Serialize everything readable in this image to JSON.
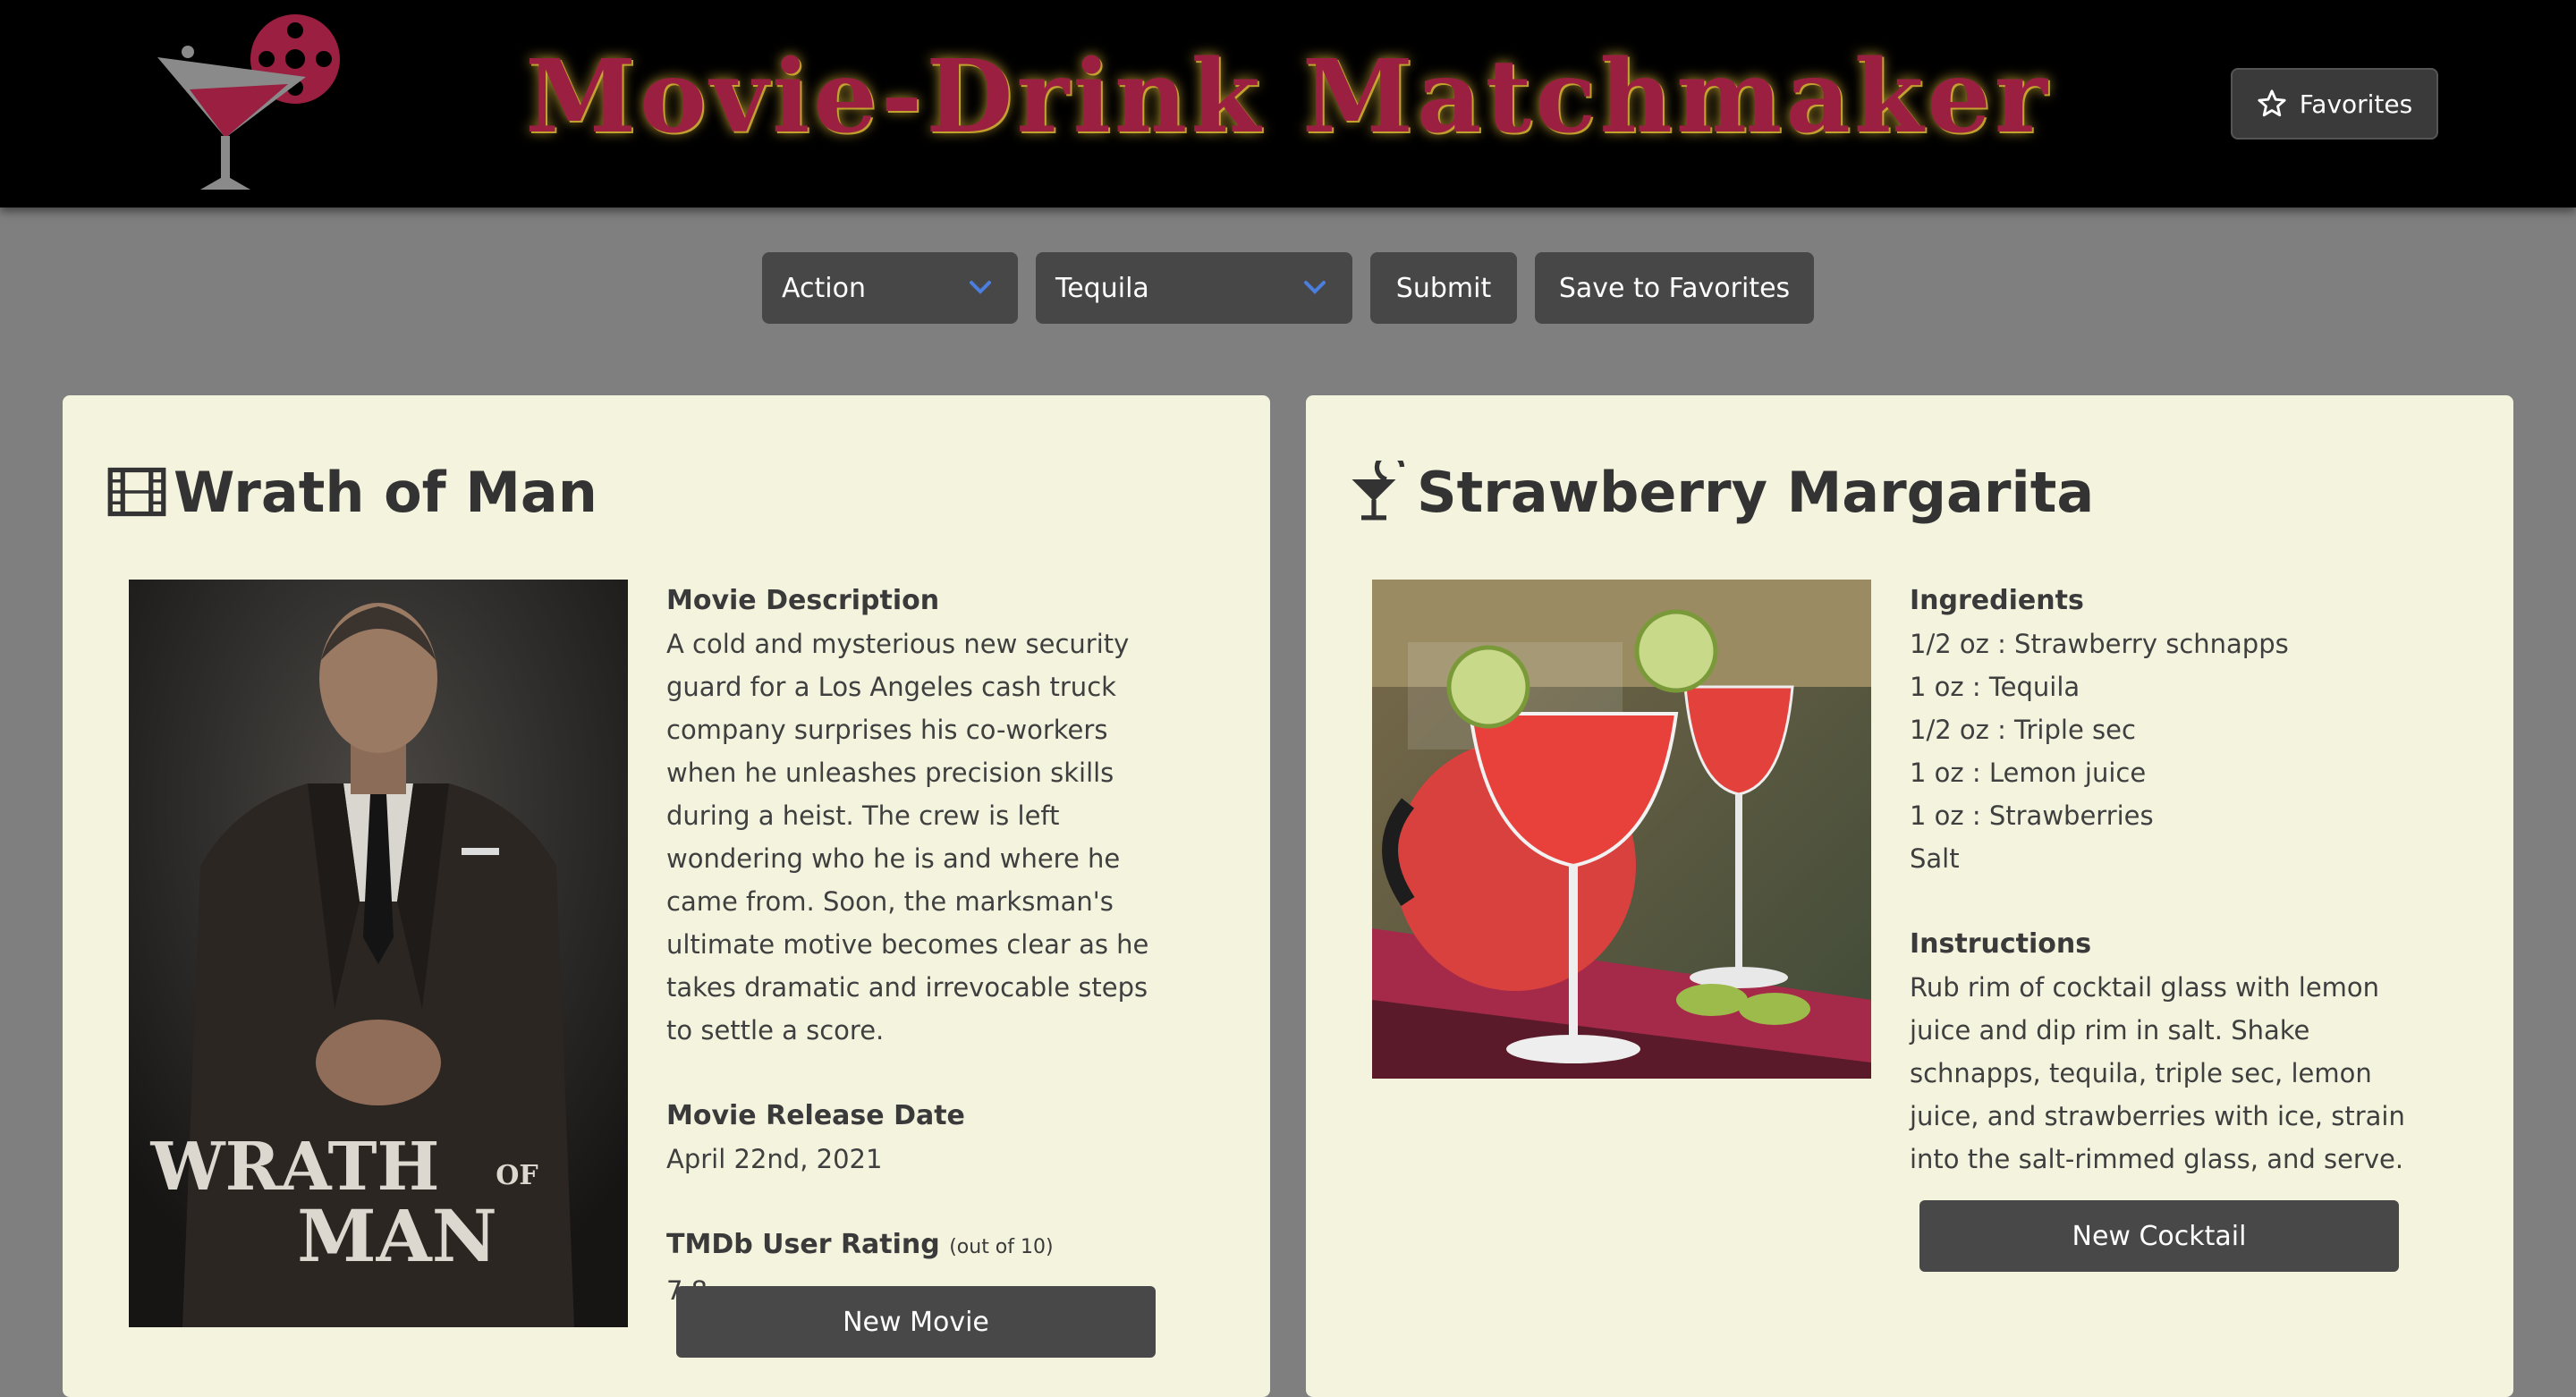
{
  "header": {
    "title": "Movie-Drink Matchmaker",
    "favorites_label": "Favorites",
    "logo_icon": "martini-film-reel-logo"
  },
  "controls": {
    "genre_select": {
      "selected": "Action"
    },
    "spirit_select": {
      "selected": "Tequila"
    },
    "submit_label": "Submit",
    "save_label": "Save to Favorites"
  },
  "movie": {
    "title": "Wrath of Man",
    "title_icon": "film-icon",
    "poster_text_1": "WRATH",
    "poster_text_of": "OF",
    "poster_text_2": "MAN",
    "description_heading": "Movie Description",
    "description": "A cold and mysterious new security guard for a Los Angeles cash truck company surprises his co-workers when he unleashes precision skills during a heist. The crew is left wondering who he is and where he came from. Soon, the marksman's ultimate motive becomes clear as he takes dramatic and irrevocable steps to settle a score.",
    "release_heading": "Movie Release Date",
    "release_date": "April 22nd, 2021",
    "rating_heading": "TMDb User Rating",
    "rating_scale": "(out of 10)",
    "rating": "7.8",
    "new_button": "New Movie"
  },
  "cocktail": {
    "title": "Strawberry Margarita",
    "title_icon": "cocktail-icon",
    "ingredients_heading": "Ingredients",
    "ingredients": [
      "1/2 oz : Strawberry schnapps",
      "1 oz : Tequila",
      "1/2 oz : Triple sec",
      "1 oz : Lemon juice",
      "1 oz : Strawberries",
      "Salt"
    ],
    "instructions_heading": "Instructions",
    "instructions": "Rub rim of cocktail glass with lemon juice and dip rim in salt. Shake schnapps, tequila, triple sec, lemon juice, and strawberries with ice, strain into the salt-rimmed glass, and serve.",
    "new_button": "New Cocktail"
  },
  "colors": {
    "header_bg": "#000000",
    "title_red": "#9a1f40",
    "title_glow": "#d4af37",
    "page_bg": "#7f7f7f",
    "card_bg": "#f3f3de",
    "button_bg": "#474747",
    "chevron_blue": "#4a7fe0"
  }
}
